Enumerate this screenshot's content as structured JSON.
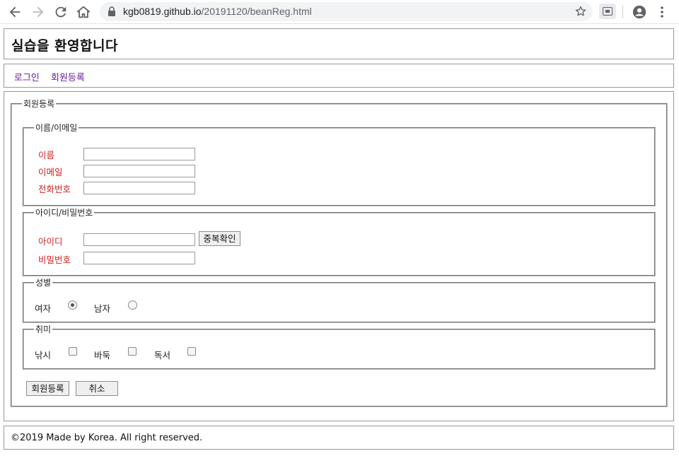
{
  "browser": {
    "url_host": "kgb0819.github.io",
    "url_path": "/20191120/beanReg.html"
  },
  "page": {
    "title": "실습을 환영합니다",
    "nav": {
      "login": "로그인",
      "register": "회원등록"
    },
    "footer": "©2019 Made by Korea. All right reserved."
  },
  "form": {
    "legend": "회원등록",
    "name_email": {
      "legend": "이름/이메일",
      "name_label": "이름",
      "email_label": "이메일",
      "phone_label": "전화번호",
      "name_value": "",
      "email_value": "",
      "phone_value": ""
    },
    "id_password": {
      "legend": "아이디/비밀번호",
      "id_label": "아이디",
      "password_label": "비밀번호",
      "id_value": "",
      "password_value": "",
      "duplicate_check_label": "중복확인"
    },
    "gender": {
      "legend": "성별",
      "female_label": "여자",
      "male_label": "남자",
      "selected": "여자"
    },
    "hobby": {
      "legend": "취미",
      "fishing_label": "낚시",
      "baduk_label": "바둑",
      "reading_label": "독서",
      "checked": []
    },
    "submit_label": "회원등록",
    "cancel_label": "취소"
  }
}
